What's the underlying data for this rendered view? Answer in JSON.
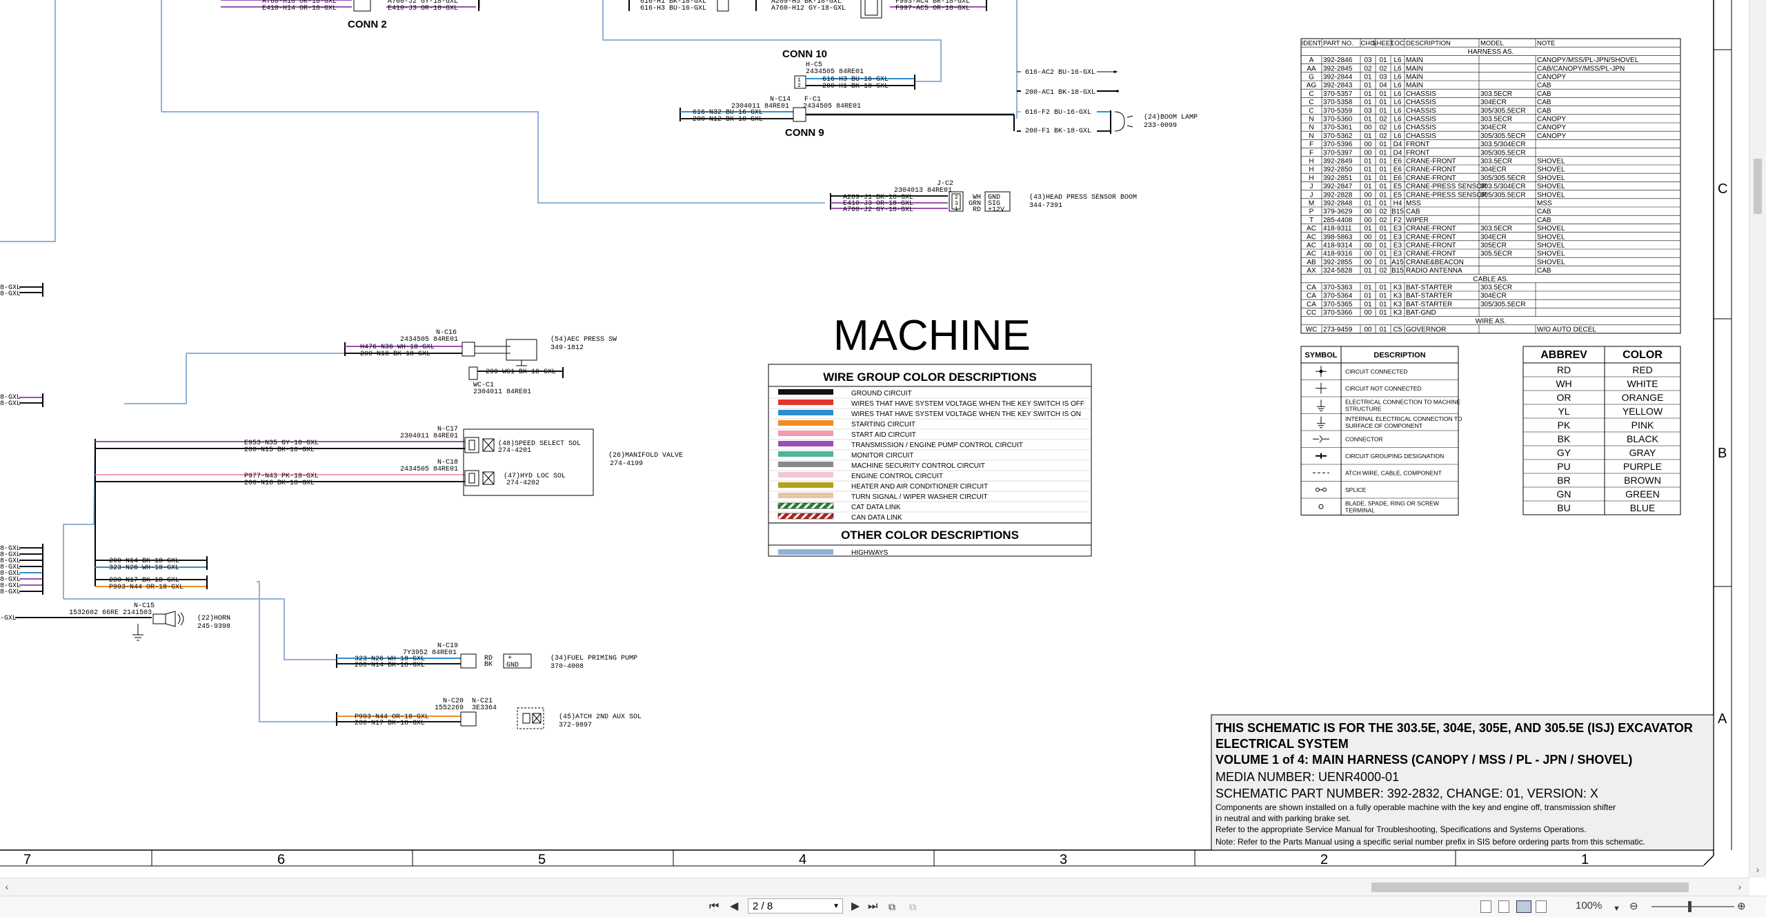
{
  "connectors": {
    "conn2": "CONN 2",
    "conn10": "CONN 10",
    "conn9": "CONN 9"
  },
  "wires_top": [
    "A760-H10 OR-18-GXL",
    "E410-H14 OR-18-GXL",
    "A760-J2 GY-18-GXL",
    "E410-J3 OR-18-GXL",
    "616-H1 BK-18-GXL",
    "616-H3 BU-16-GXL",
    "A209-H5 BK-18-GXL",
    "A760-H12 GY-18-GXL",
    "F993-AC4 BR-18-GXL",
    "F997-AC5 OR-18-GXL"
  ],
  "conn10_block": {
    "ref": "H-C5",
    "part": "2434505  84RE01",
    "wire1": "616-H3 BU-16-GXL",
    "wire2": "200-H1 BK-18-GXL"
  },
  "conn9_block": {
    "ref1": "N-C14",
    "ref2": "F-C1",
    "part1": "2304011  84RE01",
    "part2": "2434505  84RE01",
    "wire1": "616-N32 BU-16-GXL",
    "wire2": "200-N12 BK-18-GXL"
  },
  "boom_lamp": {
    "wire_a": "616-AC2 BU-16-GXL",
    "wire_b": "200-AC1 BK-18-GXL",
    "wire_c": "616-F2 BU-16-GXL",
    "wire_d": "200-F1 BK-18-GXL",
    "label": "(24)BOOM LAMP",
    "part": "233-0099"
  },
  "head_press": {
    "ref": "J-C2",
    "part": "2304013  84RE01",
    "wire1": "A209-J1 BK-18-GXL",
    "wire2": "E410-J3 OR-18-GXL",
    "wire3": "A760-J2 GY-18-GXL",
    "pin1": "GND",
    "pin2": "SIG",
    "pin3": "+12V",
    "pin1c": "WH",
    "pin2c": "GRN",
    "pin3c": "RD",
    "label": "(43)HEAD PRESS SENSOR BOOM",
    "partno": "344-7391"
  },
  "aec": {
    "ref": "N-C16",
    "part": "2434505  84RE01",
    "wire1": "H476-N36 WH-18-GXL",
    "wire2": "200-N18 BK-18-GXL",
    "label": "(54)AEC PRESS SW",
    "partno": "349-1812",
    "wc_wire": "200-WC1 BK-18-GXL",
    "wc_ref": "WC-C1",
    "wc_part": "2304011  84RE01"
  },
  "manifold": {
    "c17_ref": "N-C17",
    "c17_part": "2304011  84RE01",
    "c17_w1": "E953-N35 GY-18-GXL",
    "c17_w2": "200-N15 BK-18-GXL",
    "c17_label": "(48)SPEED SELECT SOL",
    "c17_partno": "274-4201",
    "c18_ref": "N-C18",
    "c18_part": "2434505  84RE01",
    "c18_w1": "P977-N43 PK-18-GXL",
    "c18_w2": "200-N16 BK-18-GXL",
    "c18_label": "(47)HYD LOC SOL",
    "c18_partno": "274-4202",
    "label": "(26)MANIFOLD VALVE",
    "partno": "274-4199"
  },
  "left_bundle": {
    "w1": "200-N14 BK-18-GXL",
    "w2": "323-N26 WH-18-GXL",
    "w3": "200-N17 BK-18-GXL",
    "w4": "P993-N44 OR-18-GXL",
    "gxl": "GXL",
    "gxl_a": "8-GXL",
    "gxl_b": "8-GXL"
  },
  "horn": {
    "ref": "N-C15",
    "part": "1532602  66RE 2141503",
    "label": "(22)HORN",
    "partno": "245-9398",
    "wire": "-GXL"
  },
  "fuel_pump": {
    "ref": "N-C19",
    "part": "7Y3952  84RE01",
    "w1": "323-N26 WH-18-GXL",
    "w2": "200-N14 BK-18-GXL",
    "p1": "RD",
    "p2": "BK",
    "p3": "+",
    "p4": "GND",
    "label": "(34)FUEL PRIMING PUMP",
    "partno": "370-4008"
  },
  "atch": {
    "ref1": "N-C20",
    "ref2": "N-C21",
    "part1": "1552269",
    "part2": "3E3364",
    "w1": "P993-N44 OR-18-GXL",
    "w2": "200-N17 BK-18-GXL",
    "label": "(45)ATCH 2ND AUX SOL",
    "partno": "372-9897"
  },
  "machine_title": "MACHINE",
  "wire_legend": {
    "title": "WIRE GROUP COLOR DESCRIPTIONS",
    "items": [
      {
        "color": "#111111",
        "label": "GROUND CIRCUIT"
      },
      {
        "color": "#e0342c",
        "label": "WIRES THAT HAVE SYSTEM VOLTAGE WHEN THE KEY SWITCH IS OFF"
      },
      {
        "color": "#2d8ecf",
        "label": "WIRES THAT HAVE SYSTEM VOLTAGE WHEN THE KEY SWITCH IS ON"
      },
      {
        "color": "#f08a24",
        "label": "STARTING CIRCUIT"
      },
      {
        "color": "#f29ab0",
        "label": "START AID CIRCUIT"
      },
      {
        "color": "#9a4fb0",
        "label": "TRANSMISSION / ENGINE PUMP CONTROL CIRCUIT"
      },
      {
        "color": "#4fb49a",
        "label": "MONITOR CIRCUIT"
      },
      {
        "color": "#8a8a8a",
        "label": "MACHINE SECURITY CONTROL CIRCUIT"
      },
      {
        "color": "#f4c7d2",
        "label": "ENGINE CONTROL CIRCUIT"
      },
      {
        "color": "#b3a21f",
        "label": "HEATER AND AIR CONDITIONER CIRCUIT"
      },
      {
        "color": "#e6c79f",
        "label": "TURN SIGNAL / WIPER WASHER CIRCUIT"
      },
      {
        "color": "hatch-green",
        "label": "CAT DATA LINK"
      },
      {
        "color": "hatch-red",
        "label": "CAN DATA LINK"
      }
    ],
    "other_title": "OTHER COLOR DESCRIPTIONS",
    "other_items": [
      {
        "color": "#8fb2d6",
        "label": "HIGHWAYS"
      }
    ]
  },
  "harness_table": {
    "headers": [
      "IDENT",
      "PART NO.",
      "CHG",
      "SHEET",
      "LOC",
      "DESCRIPTION",
      "MODEL",
      "NOTE"
    ],
    "section_harness": "HARNESS AS.",
    "harness_rows": [
      [
        "A",
        "392-2846",
        "03",
        "01",
        "L6",
        "MAIN",
        "",
        "CANOPY/MSS/PL-JPN/SHOVEL"
      ],
      [
        "AA",
        "392-2845",
        "02",
        "02",
        "L6",
        "MAIN",
        "",
        "CAB/CANOPY/MSS/PL-JPN"
      ],
      [
        "G",
        "392-2844",
        "01",
        "03",
        "L6",
        "MAIN",
        "",
        "CANOPY"
      ],
      [
        "AG",
        "392-2843",
        "01",
        "04",
        "L6",
        "MAIN",
        "",
        "CAB"
      ],
      [
        "C",
        "370-5357",
        "01",
        "01",
        "L6",
        "CHASSIS",
        "303.5ECR",
        "CAB"
      ],
      [
        "C",
        "370-5358",
        "01",
        "01",
        "L6",
        "CHASSIS",
        "304ECR",
        "CAB"
      ],
      [
        "C",
        "370-5359",
        "03",
        "01",
        "L6",
        "CHASSIS",
        "305/305.5ECR",
        "CAB"
      ],
      [
        "N",
        "370-5360",
        "01",
        "02",
        "L6",
        "CHASSIS",
        "303.5ECR",
        "CANOPY"
      ],
      [
        "N",
        "370-5361",
        "00",
        "02",
        "L6",
        "CHASSIS",
        "304ECR",
        "CANOPY"
      ],
      [
        "N",
        "370-5362",
        "01",
        "02",
        "L6",
        "CHASSIS",
        "305/305.5ECR",
        "CANOPY"
      ],
      [
        "F",
        "370-5396",
        "00",
        "01",
        "D4",
        "FRONT",
        "303.5/304ECR",
        ""
      ],
      [
        "F",
        "370-5397",
        "00",
        "01",
        "D4",
        "FRONT",
        "305/305.5ECR",
        ""
      ],
      [
        "H",
        "392-2849",
        "01",
        "01",
        "E6",
        "CRANE-FRONT",
        "303.5ECR",
        "SHOVEL"
      ],
      [
        "H",
        "392-2850",
        "01",
        "01",
        "E6",
        "CRANE-FRONT",
        "304ECR",
        "SHOVEL"
      ],
      [
        "H",
        "392-2851",
        "01",
        "01",
        "E6",
        "CRANE-FRONT",
        "305/305.5ECR",
        "SHOVEL"
      ],
      [
        "J",
        "392-2847",
        "01",
        "01",
        "E5",
        "CRANE-PRESS SENSOR",
        "303.5/304ECR",
        "SHOVEL"
      ],
      [
        "J",
        "392-2828",
        "00",
        "01",
        "E5",
        "CRANE-PRESS SENSOR",
        "305/305.5ECR",
        "SHOVEL"
      ],
      [
        "M",
        "392-2848",
        "01",
        "01",
        "H4",
        "MSS",
        "",
        "MSS"
      ],
      [
        "P",
        "379-3629",
        "00",
        "02",
        "B15",
        "CAB",
        "",
        "CAB"
      ],
      [
        "T",
        "285-4408",
        "00",
        "02",
        "F2",
        "WIPER",
        "",
        "CAB"
      ],
      [
        "AC",
        "418-9311",
        "01",
        "01",
        "E3",
        "CRANE-FRONT",
        "303.5ECR",
        "SHOVEL"
      ],
      [
        "AC",
        "398-5863",
        "00",
        "01",
        "E3",
        "CRANE-FRONT",
        "304ECR",
        "SHOVEL"
      ],
      [
        "AC",
        "418-9314",
        "00",
        "01",
        "E3",
        "CRANE-FRONT",
        "305ECR",
        "SHOVEL"
      ],
      [
        "AC",
        "418-9316",
        "00",
        "01",
        "E3",
        "CRANE-FRONT",
        "305.5ECR",
        "SHOVEL"
      ],
      [
        "AB",
        "392-2855",
        "00",
        "01",
        "A15",
        "CRANE&BEACON",
        "",
        "SHOVEL"
      ],
      [
        "AX",
        "324-5828",
        "01",
        "02",
        "B15",
        "RADIO ANTENNA",
        "",
        "CAB"
      ]
    ],
    "section_cable": "CABLE AS.",
    "cable_rows": [
      [
        "CA",
        "370-5363",
        "01",
        "01",
        "K3",
        "BAT-STARTER",
        "303.5ECR",
        ""
      ],
      [
        "CA",
        "370-5364",
        "01",
        "01",
        "K3",
        "BAT-STARTER",
        "304ECR",
        ""
      ],
      [
        "CA",
        "370-5365",
        "01",
        "01",
        "K3",
        "BAT-STARTER",
        "305/305.5ECR",
        ""
      ],
      [
        "CC",
        "370-5366",
        "00",
        "01",
        "K3",
        "BAT-GND",
        "",
        ""
      ]
    ],
    "section_wire": "WIRE AS.",
    "wire_rows": [
      [
        "WC",
        "273-9459",
        "00",
        "01",
        "C5",
        "GOVERNOR",
        "",
        "W/O AUTO DECEL"
      ]
    ]
  },
  "symbol_table": {
    "headers": [
      "SYMBOL",
      "DESCRIPTION"
    ],
    "rows": [
      {
        "icon": "connected-dot-icon",
        "label": "CIRCUIT CONNECTED"
      },
      {
        "icon": "cross-icon",
        "label": "CIRCUIT NOT CONNECTED"
      },
      {
        "icon": "ground-machine-icon",
        "label": "ELECTRICAL CONNECTION TO MACHINE STRUCTURE"
      },
      {
        "icon": "ground-component-icon",
        "label": "INTERNAL ELECTRICAL CONNECTION TO SURFACE OF COMPONENT"
      },
      {
        "icon": "connector-icon",
        "label": "CONNECTOR"
      },
      {
        "icon": "grouping-icon",
        "label": "CIRCUIT GROUPING DESIGNATION"
      },
      {
        "icon": "dashed-line-icon",
        "label": "ATCH WIRE, CABLE, COMPONENT"
      },
      {
        "icon": "splice-icon",
        "label": "SPLICE"
      },
      {
        "icon": "terminal-icon",
        "label": "BLADE, SPADE, RING OR SCREW TERMINAL"
      }
    ]
  },
  "abbrev_table": {
    "headers": [
      "ABBREV",
      "COLOR"
    ],
    "rows": [
      [
        "RD",
        "RED"
      ],
      [
        "WH",
        "WHITE"
      ],
      [
        "OR",
        "ORANGE"
      ],
      [
        "YL",
        "YELLOW"
      ],
      [
        "PK",
        "PINK"
      ],
      [
        "BK",
        "BLACK"
      ],
      [
        "GY",
        "GRAY"
      ],
      [
        "PU",
        "PURPLE"
      ],
      [
        "BR",
        "BROWN"
      ],
      [
        "GN",
        "GREEN"
      ],
      [
        "BU",
        "BLUE"
      ]
    ]
  },
  "title_block": {
    "line1": "THIS SCHEMATIC IS FOR THE 303.5E, 304E, 305E, AND 305.5E (ISJ) EXCAVATOR",
    "line2": "ELECTRICAL SYSTEM",
    "line3": "VOLUME 1 of 4: MAIN HARNESS (CANOPY / MSS / PL - JPN / SHOVEL)",
    "line4": "MEDIA NUMBER: UENR4000-01",
    "line5": "SCHEMATIC PART NUMBER: 392-2832, CHANGE: 01, VERSION: X",
    "line6": "Components are shown installed on a fully operable machine with the key and engine off, transmission shifter",
    "line7": "in neutral and with parking brake set.",
    "line8": "Refer to the appropriate Service Manual for Troubleshooting, Specifications and Systems Operations.",
    "line9": "Note: Refer to the Parts Manual using a specific serial number prefix in SIS before ordering parts from this schematic."
  },
  "grid": {
    "cols": [
      "7",
      "6",
      "5",
      "4",
      "3",
      "2",
      "1"
    ],
    "rows": [
      "C",
      "B",
      "A"
    ]
  },
  "toolbar": {
    "page": "2 / 8",
    "zoom": "100%"
  }
}
